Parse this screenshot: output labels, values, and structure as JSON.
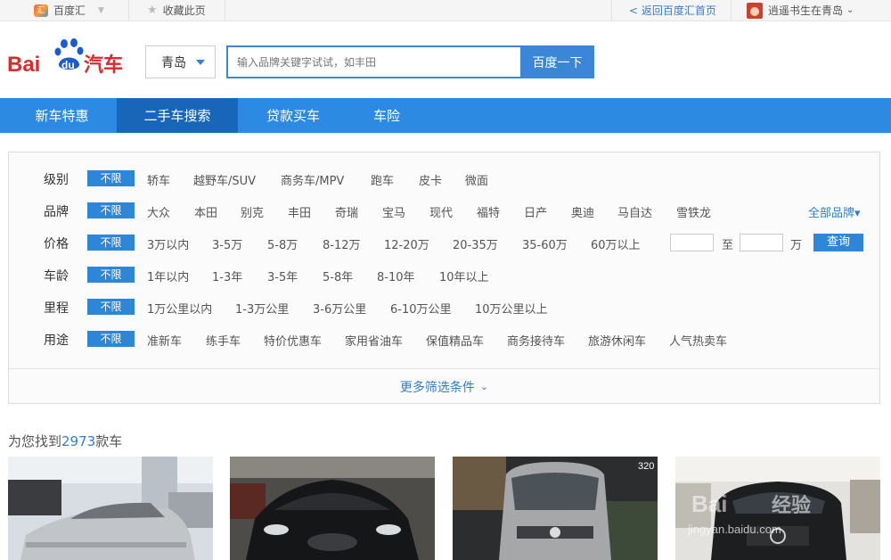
{
  "topbar": {
    "brand": "百度汇",
    "bookmark": "收藏此页",
    "back_link": "< 返回百度汇首页",
    "user": "逍遥书生在青岛"
  },
  "header": {
    "logo_text_latin": "Bai",
    "logo_text_du": "du",
    "logo_text_cn": "汽车",
    "city": "青岛",
    "search_placeholder": "输入品牌关键字试试，如丰田",
    "search_button": "百度一下"
  },
  "nav": {
    "tabs": [
      "新车特惠",
      "二手车搜索",
      "贷款买车",
      "车险"
    ],
    "active_index": 1
  },
  "filters": {
    "any_label": "不限",
    "rows": [
      {
        "label": "级别",
        "options": [
          "轿车",
          "越野车/SUV",
          "商务车/MPV",
          "跑车",
          "皮卡",
          "微面"
        ]
      },
      {
        "label": "品牌",
        "options": [
          "大众",
          "本田",
          "别克",
          "丰田",
          "奇瑞",
          "宝马",
          "现代",
          "福特",
          "日产",
          "奥迪",
          "马自达",
          "雪铁龙"
        ]
      },
      {
        "label": "价格",
        "options": [
          "3万以内",
          "3-5万",
          "5-8万",
          "8-12万",
          "12-20万",
          "20-35万",
          "35-60万",
          "60万以上"
        ]
      },
      {
        "label": "车龄",
        "options": [
          "1年以内",
          "1-3年",
          "3-5年",
          "5-8年",
          "8-10年",
          "10年以上"
        ]
      },
      {
        "label": "里程",
        "options": [
          "1万公里以内",
          "1-3万公里",
          "3-6万公里",
          "6-10万公里",
          "10万公里以上"
        ]
      },
      {
        "label": "用途",
        "options": [
          "准新车",
          "练手车",
          "特价优惠车",
          "家用省油车",
          "保值精品车",
          "商务接待车",
          "旅游休闲车",
          "人气热卖车"
        ]
      }
    ],
    "all_brands": "全部品牌▾",
    "price_to": "至",
    "price_unit": "万",
    "query_button": "查询",
    "more": "更多筛选条件"
  },
  "results": {
    "prefix": "为您找到",
    "count": "2973",
    "suffix": "款车"
  },
  "cars": [
    {
      "name": "silver-bmw-sedan",
      "body": "#c7c9cc"
    },
    {
      "name": "black-jaguar-sedan",
      "body": "#1c1d20"
    },
    {
      "name": "silver-benz-van",
      "body": "#a9aaab",
      "tag": "320"
    },
    {
      "name": "black-benz-suv",
      "body": "#222325",
      "watermark": "jingyan.baidu.com"
    }
  ]
}
